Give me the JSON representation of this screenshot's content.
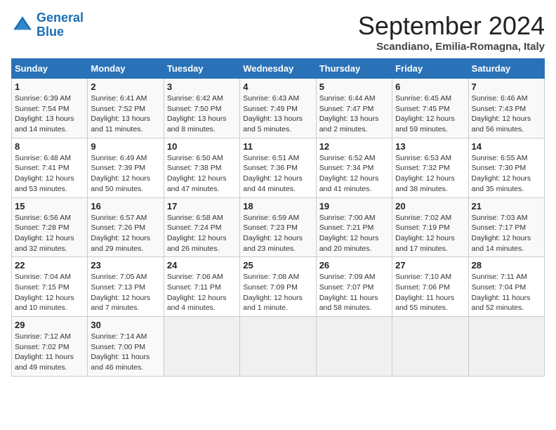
{
  "logo": {
    "line1": "General",
    "line2": "Blue"
  },
  "title": "September 2024",
  "subtitle": "Scandiano, Emilia-Romagna, Italy",
  "days_of_week": [
    "Sunday",
    "Monday",
    "Tuesday",
    "Wednesday",
    "Thursday",
    "Friday",
    "Saturday"
  ],
  "weeks": [
    [
      {
        "day": "1",
        "sunrise": "6:39 AM",
        "sunset": "7:54 PM",
        "daylight": "13 hours and 14 minutes."
      },
      {
        "day": "2",
        "sunrise": "6:41 AM",
        "sunset": "7:52 PM",
        "daylight": "13 hours and 11 minutes."
      },
      {
        "day": "3",
        "sunrise": "6:42 AM",
        "sunset": "7:50 PM",
        "daylight": "13 hours and 8 minutes."
      },
      {
        "day": "4",
        "sunrise": "6:43 AM",
        "sunset": "7:49 PM",
        "daylight": "13 hours and 5 minutes."
      },
      {
        "day": "5",
        "sunrise": "6:44 AM",
        "sunset": "7:47 PM",
        "daylight": "13 hours and 2 minutes."
      },
      {
        "day": "6",
        "sunrise": "6:45 AM",
        "sunset": "7:45 PM",
        "daylight": "12 hours and 59 minutes."
      },
      {
        "day": "7",
        "sunrise": "6:46 AM",
        "sunset": "7:43 PM",
        "daylight": "12 hours and 56 minutes."
      }
    ],
    [
      {
        "day": "8",
        "sunrise": "6:48 AM",
        "sunset": "7:41 PM",
        "daylight": "12 hours and 53 minutes."
      },
      {
        "day": "9",
        "sunrise": "6:49 AM",
        "sunset": "7:39 PM",
        "daylight": "12 hours and 50 minutes."
      },
      {
        "day": "10",
        "sunrise": "6:50 AM",
        "sunset": "7:38 PM",
        "daylight": "12 hours and 47 minutes."
      },
      {
        "day": "11",
        "sunrise": "6:51 AM",
        "sunset": "7:36 PM",
        "daylight": "12 hours and 44 minutes."
      },
      {
        "day": "12",
        "sunrise": "6:52 AM",
        "sunset": "7:34 PM",
        "daylight": "12 hours and 41 minutes."
      },
      {
        "day": "13",
        "sunrise": "6:53 AM",
        "sunset": "7:32 PM",
        "daylight": "12 hours and 38 minutes."
      },
      {
        "day": "14",
        "sunrise": "6:55 AM",
        "sunset": "7:30 PM",
        "daylight": "12 hours and 35 minutes."
      }
    ],
    [
      {
        "day": "15",
        "sunrise": "6:56 AM",
        "sunset": "7:28 PM",
        "daylight": "12 hours and 32 minutes."
      },
      {
        "day": "16",
        "sunrise": "6:57 AM",
        "sunset": "7:26 PM",
        "daylight": "12 hours and 29 minutes."
      },
      {
        "day": "17",
        "sunrise": "6:58 AM",
        "sunset": "7:24 PM",
        "daylight": "12 hours and 26 minutes."
      },
      {
        "day": "18",
        "sunrise": "6:59 AM",
        "sunset": "7:23 PM",
        "daylight": "12 hours and 23 minutes."
      },
      {
        "day": "19",
        "sunrise": "7:00 AM",
        "sunset": "7:21 PM",
        "daylight": "12 hours and 20 minutes."
      },
      {
        "day": "20",
        "sunrise": "7:02 AM",
        "sunset": "7:19 PM",
        "daylight": "12 hours and 17 minutes."
      },
      {
        "day": "21",
        "sunrise": "7:03 AM",
        "sunset": "7:17 PM",
        "daylight": "12 hours and 14 minutes."
      }
    ],
    [
      {
        "day": "22",
        "sunrise": "7:04 AM",
        "sunset": "7:15 PM",
        "daylight": "12 hours and 10 minutes."
      },
      {
        "day": "23",
        "sunrise": "7:05 AM",
        "sunset": "7:13 PM",
        "daylight": "12 hours and 7 minutes."
      },
      {
        "day": "24",
        "sunrise": "7:06 AM",
        "sunset": "7:11 PM",
        "daylight": "12 hours and 4 minutes."
      },
      {
        "day": "25",
        "sunrise": "7:08 AM",
        "sunset": "7:09 PM",
        "daylight": "12 hours and 1 minute."
      },
      {
        "day": "26",
        "sunrise": "7:09 AM",
        "sunset": "7:07 PM",
        "daylight": "11 hours and 58 minutes."
      },
      {
        "day": "27",
        "sunrise": "7:10 AM",
        "sunset": "7:06 PM",
        "daylight": "11 hours and 55 minutes."
      },
      {
        "day": "28",
        "sunrise": "7:11 AM",
        "sunset": "7:04 PM",
        "daylight": "11 hours and 52 minutes."
      }
    ],
    [
      {
        "day": "29",
        "sunrise": "7:12 AM",
        "sunset": "7:02 PM",
        "daylight": "11 hours and 49 minutes."
      },
      {
        "day": "30",
        "sunrise": "7:14 AM",
        "sunset": "7:00 PM",
        "daylight": "11 hours and 46 minutes."
      },
      null,
      null,
      null,
      null,
      null
    ]
  ]
}
